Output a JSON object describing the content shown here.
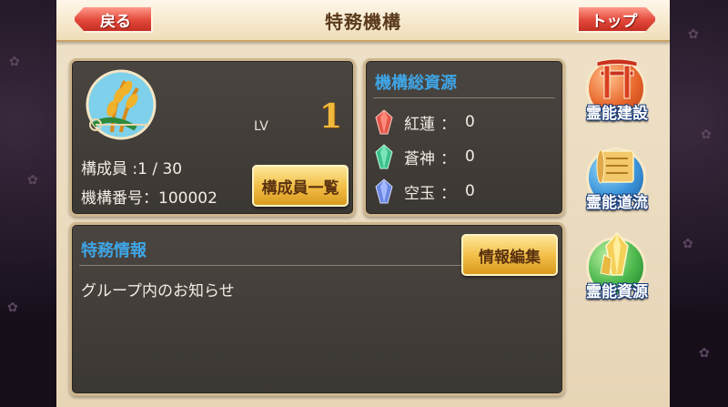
{
  "header": {
    "title": "特務機構",
    "back_label": "戻る",
    "top_label": "トップ"
  },
  "organization": {
    "level_label": "LV",
    "level_value": "1",
    "members_text": "構成員 :1 / 30",
    "id_text": "機構番号：100002",
    "members_button": "構成員一覧"
  },
  "resources": {
    "title": "機構総資源",
    "items": [
      {
        "name": "紅蓮",
        "value": "0",
        "color": "#e2564a",
        "icon": "red-crystal-icon"
      },
      {
        "name": "蒼神",
        "value": "0",
        "color": "#3bbf8a",
        "icon": "green-crystal-icon"
      },
      {
        "name": "空玉",
        "value": "0",
        "color": "#6a86e0",
        "icon": "blue-crystal-icon"
      }
    ]
  },
  "info": {
    "title": "特務情報",
    "edit_button": "情報編集",
    "notice": "グループ内のお知らせ"
  },
  "side_buttons": [
    {
      "label": "霊能建設",
      "icon": "torii-gate-icon"
    },
    {
      "label": "霊能道流",
      "icon": "scroll-icon"
    },
    {
      "label": "霊能資源",
      "icon": "crystal-icon"
    }
  ],
  "colors": {
    "accent_blue": "#3fa5e6",
    "level_gold": "#f1b93b",
    "nav_red": "#e3483a"
  }
}
